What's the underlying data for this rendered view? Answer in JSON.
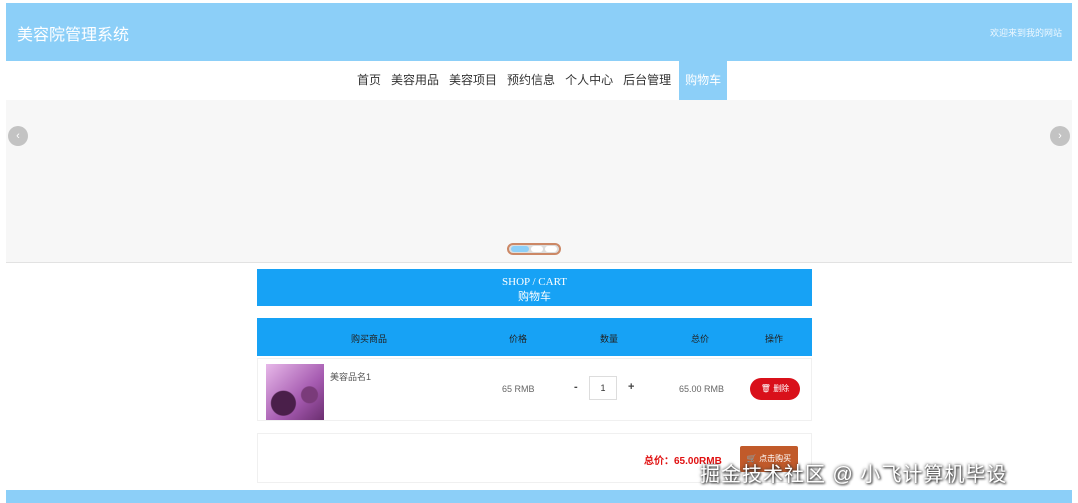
{
  "header": {
    "title": "美容院管理系统",
    "welcome": "欢迎来到我的网站"
  },
  "nav": {
    "items": [
      "首页",
      "美容用品",
      "美容项目",
      "预约信息",
      "个人中心",
      "后台管理"
    ],
    "active": "购物车"
  },
  "banner": {
    "prev_icon": "chevron-left-icon",
    "next_icon": "chevron-right-icon",
    "prev_glyph": "‹",
    "next_glyph": "›"
  },
  "cart": {
    "title_en": "SHOP / CART",
    "title_cn": "购物车",
    "columns": [
      "购买商品",
      "价格",
      "数量",
      "总价",
      "操作"
    ],
    "items": [
      {
        "name": "美容品名1",
        "price": "65 RMB",
        "quantity": "1",
        "total": "65.00 RMB",
        "delete_label": "删除"
      }
    ],
    "qty_minus": "-",
    "qty_plus": "+",
    "grand_total": "总价：65.00RMB",
    "checkout_label": "点击购买"
  },
  "watermark": "掘金技术社区 @ 小飞计算机毕设",
  "colors": {
    "primary": "#8ccff8",
    "accent": "#17a2f5",
    "danger": "#d9101a",
    "buy": "#c15a2a"
  }
}
